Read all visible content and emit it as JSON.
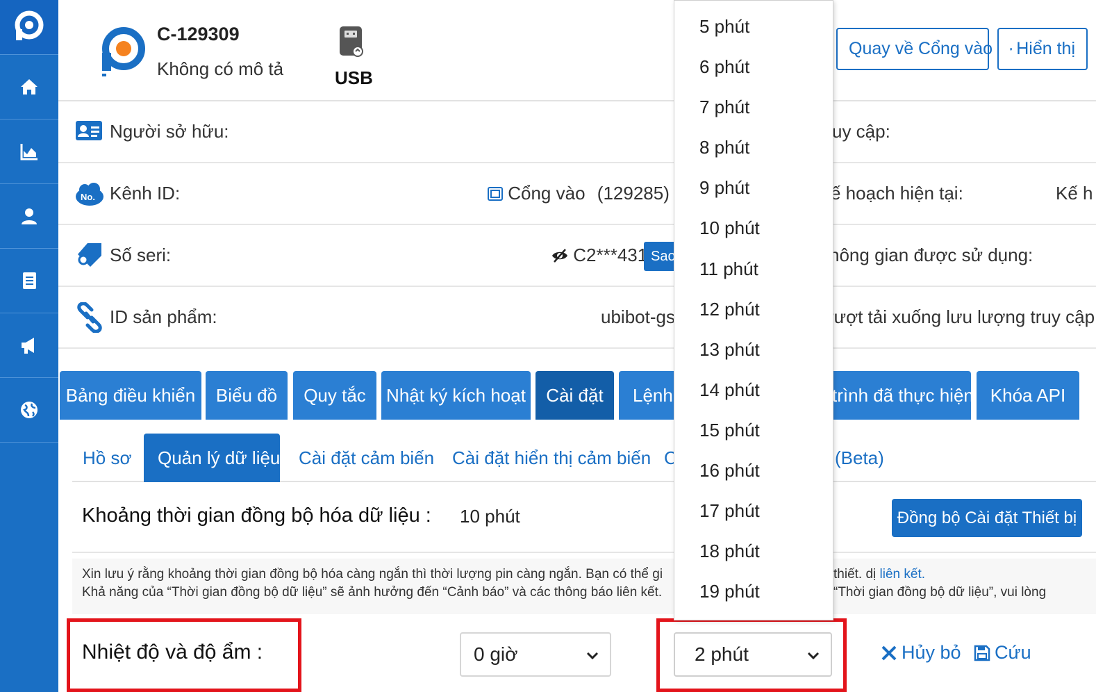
{
  "sidebar": {
    "items": [
      {
        "icon": "home-icon"
      },
      {
        "icon": "chart-icon"
      },
      {
        "icon": "user-icon"
      },
      {
        "icon": "document-icon"
      },
      {
        "icon": "megaphone-icon"
      },
      {
        "icon": "globe-icon"
      }
    ]
  },
  "header": {
    "device_name": "C-129309",
    "device_desc": "Không có mô tả",
    "usb_label": "USB",
    "back_button": "Quay về Cổng vào",
    "show_button": "Hiển thị"
  },
  "info": {
    "owner_label": "Người sở hữu:",
    "access_label": "uy cập:",
    "channel_label": "Kênh ID:",
    "gateway_link": "Cổng vào",
    "gateway_id": "(129285)",
    "plan_label": "ế hoạch hiện tại:",
    "plan_value": "Kế h",
    "serial_label": "Số seri:",
    "serial_value": "C2***431",
    "copy_button": "Sao",
    "usage_label": "hông gian được sử dụng:",
    "product_label": "ID sản phẩm:",
    "product_value": "ubibot-gs,",
    "download_label": "rượt tải xuống lưu lượng truy cập"
  },
  "main_tabs": [
    "Bảng điều khiển",
    "Biểu đồ",
    "Quy tắc",
    "Nhật ký kích hoạt",
    "Cài đặt",
    "Lệnh",
    "trình đã thực hiện",
    "Khóa API"
  ],
  "sub_tabs": [
    "Hồ sơ",
    "Quản lý dữ liệu",
    "Cài đặt cảm biến",
    "Cài đặt hiển thị cảm biến",
    "C",
    "(Beta)"
  ],
  "sync": {
    "label": "Khoảng thời gian đồng bộ hóa dữ liệu  :",
    "value": "10 phút",
    "button": "Đồng bộ Cài đặt Thiết bị"
  },
  "notice": {
    "line1_left": "Xin lưu ý rằng khoảng thời gian đồng bộ hóa càng ngắn thì thời lượng pin càng ngắn. Bạn có thể gi",
    "line1_right": " thiết. dị",
    "line1_link": "liên kết.",
    "line2_left": "Khả năng của “Thời gian đồng bộ dữ liệu” sẽ ảnh hưởng đến “Cảnh báo” và các thông báo liên kết.",
    "line2_right": "“Thời gian đồng bộ  dữ  liệu”, vui lòng"
  },
  "sensor": {
    "label": "Nhiệt độ và độ ẩm  :",
    "hours_value": "0 giờ",
    "minutes_value": "2 phút",
    "cancel": "Hủy bỏ",
    "save": "Cứu"
  },
  "dropdown": {
    "options": [
      "5 phút",
      "6 phút",
      "7 phút",
      "8 phút",
      "9 phút",
      "10 phút",
      "11 phút",
      "12 phút",
      "13 phút",
      "14 phút",
      "15 phút",
      "16 phút",
      "17 phút",
      "18 phút",
      "19 phút"
    ]
  },
  "colors": {
    "primary": "#1a6fc4",
    "highlight": "#e3141b",
    "logo_orange": "#f5821f"
  }
}
